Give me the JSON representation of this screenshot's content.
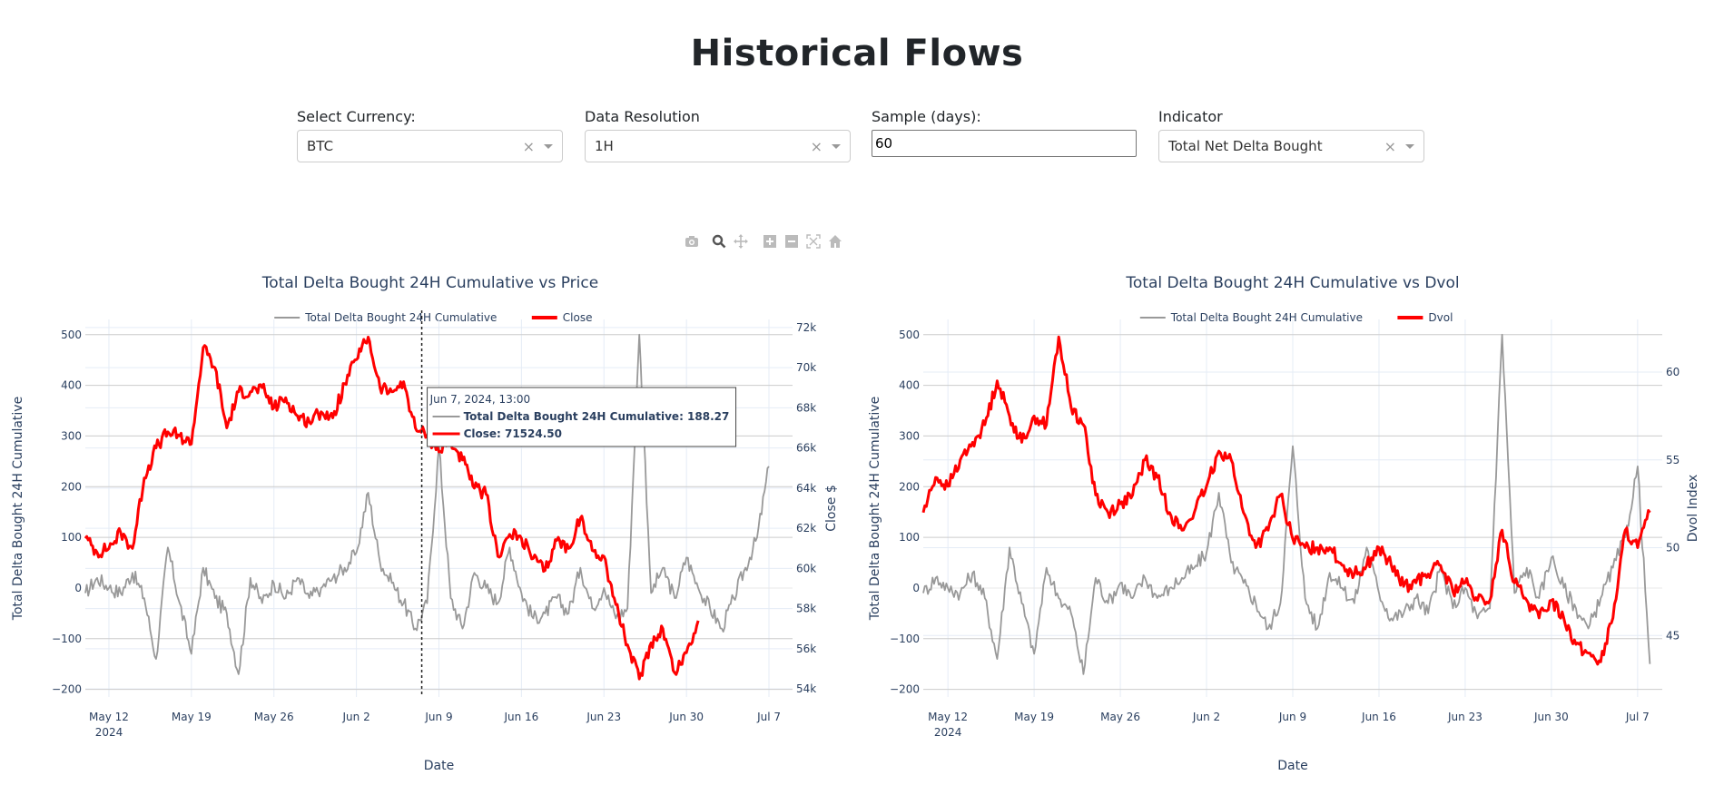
{
  "page": {
    "title": "Historical Flows"
  },
  "controls": {
    "currency": {
      "label": "Select Currency:",
      "value": "BTC"
    },
    "resolution": {
      "label": "Data Resolution",
      "value": "1H"
    },
    "sample": {
      "label": "Sample (days):",
      "value": "60"
    },
    "indicator": {
      "label": "Indicator",
      "value": "Total Net Delta Bought"
    },
    "clear_glyph": "×"
  },
  "modebar": [
    "camera-icon",
    "zoom-icon",
    "pan-icon",
    "zoom-in-icon",
    "zoom-out-icon",
    "autoscale-icon",
    "reset-axes-icon"
  ],
  "colors": {
    "delta": "#999999",
    "price": "#ff0000",
    "text": "#2a3f5f",
    "grid": "#e5ecf6",
    "zeroline": "#cccccc"
  },
  "hover": {
    "date": "Jun 7, 2024, 13:00",
    "line1": "Total Delta Bought 24H Cumulative: 188.27",
    "line2": "Close: 71524.50"
  },
  "chart_data": [
    {
      "type": "line",
      "title": "Total Delta Bought 24H Cumulative vs Price",
      "xlabel": "Date",
      "ylabel": "Total Delta Bought 24H Cumulative",
      "y2label": "Close $",
      "x_ticks": [
        "May 12",
        "May 19",
        "May 26",
        "Jun 2",
        "Jun 9",
        "Jun 16",
        "Jun 23",
        "Jun 30",
        "Jul 7"
      ],
      "x_year_label": "2024",
      "x_range": [
        "2024-05-10",
        "2024-07-09"
      ],
      "ylim": [
        -215,
        530
      ],
      "y_ticks": [
        -200,
        -100,
        0,
        100,
        200,
        300,
        400,
        500
      ],
      "y_tick_labels": [
        "−200",
        "−100",
        "0",
        "100",
        "200",
        "300",
        "400",
        "500"
      ],
      "y2lim": [
        53600,
        72400
      ],
      "y2_ticks": [
        54000,
        56000,
        58000,
        60000,
        62000,
        64000,
        66000,
        68000,
        70000,
        72000
      ],
      "y2_tick_labels": [
        "54k",
        "56k",
        "58k",
        "60k",
        "62k",
        "64k",
        "66k",
        "68k",
        "70k",
        "72k"
      ],
      "legend": [
        "Total Delta Bought 24H Cumulative",
        "Close"
      ],
      "legend_position": "top-center",
      "hover_x": "2024-06-07T13:00",
      "series": [
        {
          "name": "Total Delta Bought 24H Cumulative",
          "axis": "y",
          "color": "#999999",
          "x_days": [
            0,
            1,
            2,
            3,
            4,
            5,
            6,
            7,
            8,
            9,
            10,
            11,
            12,
            13,
            14,
            15,
            16,
            17,
            18,
            19,
            20,
            21,
            22,
            23,
            24,
            25,
            26,
            27,
            28,
            29,
            30,
            31,
            32,
            33,
            34,
            35,
            36,
            37,
            38,
            39,
            40,
            41,
            42,
            43,
            44,
            45,
            46,
            47,
            48,
            49,
            50,
            51,
            52,
            53,
            54,
            55,
            56,
            57,
            58
          ],
          "values": [
            -10,
            20,
            0,
            -10,
            30,
            -20,
            -140,
            80,
            -30,
            -130,
            40,
            -20,
            -50,
            -170,
            20,
            -30,
            10,
            -20,
            20,
            -20,
            0,
            20,
            40,
            70,
            188,
            50,
            10,
            -30,
            -80,
            -30,
            280,
            -20,
            -80,
            30,
            0,
            -30,
            80,
            -10,
            -60,
            -50,
            -20,
            -50,
            40,
            -40,
            0,
            -60,
            -40,
            500,
            -10,
            40,
            -20,
            60,
            0,
            -40,
            -80,
            -20,
            40,
            100,
            240
          ],
          "x_start": "2024-05-10"
        },
        {
          "name": "Close",
          "axis": "y2",
          "color": "#ff0000",
          "x_days": [
            0,
            1,
            2,
            3,
            4,
            5,
            6,
            7,
            8,
            9,
            10,
            11,
            12,
            13,
            14,
            15,
            16,
            17,
            18,
            19,
            20,
            21,
            22,
            23,
            24,
            25,
            26,
            27,
            28,
            29,
            30,
            31,
            32,
            33,
            34,
            35,
            36,
            37,
            38,
            39,
            40,
            41,
            42,
            43,
            44,
            45,
            46,
            47,
            48,
            49,
            50,
            51,
            52,
            53,
            54,
            55,
            56,
            57,
            58
          ],
          "values": [
            61500,
            60800,
            61000,
            61800,
            61000,
            64500,
            66000,
            66800,
            66600,
            66200,
            71000,
            70000,
            67000,
            68800,
            68800,
            69000,
            68000,
            68500,
            67600,
            67300,
            67800,
            67500,
            69200,
            70400,
            71524,
            69000,
            68800,
            69300,
            67000,
            66600,
            65800,
            66300,
            65400,
            64000,
            63700,
            60600,
            61700,
            61500,
            60500,
            59900,
            61400,
            61000,
            62500,
            60900,
            60600,
            58200,
            56200,
            54500,
            56300,
            57000,
            54800,
            55800,
            57400
          ],
          "x_start": "2024-05-10"
        }
      ]
    },
    {
      "type": "line",
      "title": "Total Delta Bought 24H Cumulative vs Dvol",
      "xlabel": "Date",
      "ylabel": "Total Delta Bought 24H Cumulative",
      "y2label": "Dvol Index",
      "x_ticks": [
        "May 12",
        "May 19",
        "May 26",
        "Jun 2",
        "Jun 9",
        "Jun 16",
        "Jun 23",
        "Jun 30",
        "Jul 7"
      ],
      "x_year_label": "2024",
      "x_range": [
        "2024-05-10",
        "2024-07-09"
      ],
      "ylim": [
        -215,
        530
      ],
      "y_ticks": [
        -200,
        -100,
        0,
        100,
        200,
        300,
        400,
        500
      ],
      "y_tick_labels": [
        "−200",
        "−100",
        "0",
        "100",
        "200",
        "300",
        "400",
        "500"
      ],
      "y2lim": [
        41.5,
        63
      ],
      "y2_ticks": [
        45,
        50,
        55,
        60
      ],
      "y2_tick_labels": [
        "45",
        "50",
        "55",
        "60"
      ],
      "legend": [
        "Total Delta Bought 24H Cumulative",
        "Dvol"
      ],
      "legend_position": "top-center",
      "series": [
        {
          "name": "Total Delta Bought 24H Cumulative",
          "axis": "y",
          "color": "#999999",
          "x_days": [
            0,
            1,
            2,
            3,
            4,
            5,
            6,
            7,
            8,
            9,
            10,
            11,
            12,
            13,
            14,
            15,
            16,
            17,
            18,
            19,
            20,
            21,
            22,
            23,
            24,
            25,
            26,
            27,
            28,
            29,
            30,
            31,
            32,
            33,
            34,
            35,
            36,
            37,
            38,
            39,
            40,
            41,
            42,
            43,
            44,
            45,
            46,
            47,
            48,
            49,
            50,
            51,
            52,
            53,
            54,
            55,
            56,
            57,
            58,
            59
          ],
          "values": [
            -10,
            20,
            0,
            -10,
            30,
            -20,
            -140,
            80,
            -30,
            -130,
            40,
            -20,
            -50,
            -170,
            20,
            -30,
            10,
            -20,
            20,
            -20,
            0,
            20,
            40,
            70,
            188,
            50,
            10,
            -30,
            -80,
            -30,
            280,
            -20,
            -80,
            30,
            0,
            -30,
            80,
            -10,
            -60,
            -50,
            -20,
            -50,
            40,
            -40,
            0,
            -60,
            -40,
            500,
            -10,
            40,
            -20,
            60,
            0,
            -40,
            -80,
            -20,
            40,
            100,
            240,
            -150
          ],
          "x_start": "2024-05-10"
        },
        {
          "name": "Dvol",
          "axis": "y2",
          "color": "#ff0000",
          "x_days": [
            0,
            1,
            2,
            3,
            4,
            5,
            6,
            7,
            8,
            9,
            10,
            11,
            12,
            13,
            14,
            15,
            16,
            17,
            18,
            19,
            20,
            21,
            22,
            23,
            24,
            25,
            26,
            27,
            28,
            29,
            30,
            31,
            32,
            33,
            34,
            35,
            36,
            37,
            38,
            39,
            40,
            41,
            42,
            43,
            44,
            45,
            46,
            47,
            48,
            49,
            50,
            51,
            52,
            53,
            54,
            55,
            56,
            57,
            58,
            59
          ],
          "values": [
            52,
            54,
            53.5,
            55,
            56,
            57,
            59.5,
            57.5,
            56,
            57.5,
            57,
            62,
            58,
            57,
            53,
            52,
            52.5,
            53,
            55,
            54,
            52,
            51,
            52,
            53.5,
            55.5,
            55,
            52,
            50,
            51,
            53,
            50.5,
            50,
            50,
            50,
            49,
            48.5,
            49,
            50,
            49,
            47.8,
            48,
            48.5,
            49,
            47.5,
            48,
            47,
            47,
            51,
            48,
            47,
            46,
            47,
            46,
            44.5,
            44,
            43.5,
            46,
            51,
            50,
            52
          ],
          "x_start": "2024-05-10"
        }
      ]
    }
  ]
}
